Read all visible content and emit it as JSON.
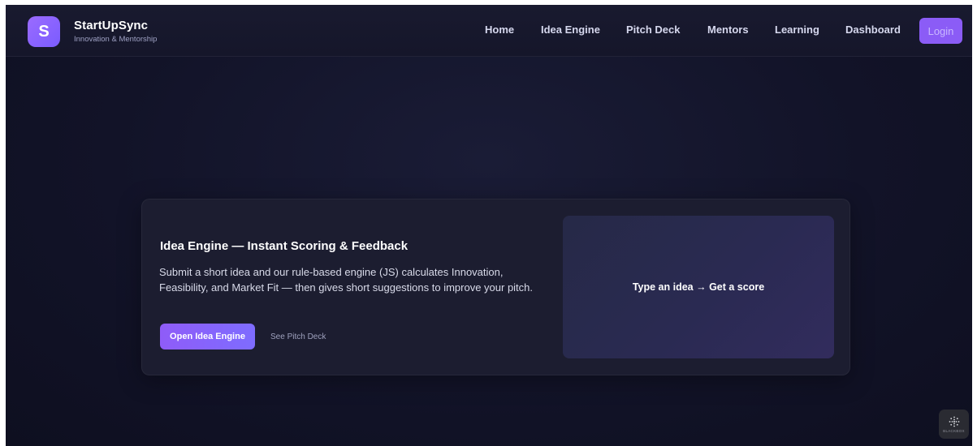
{
  "brand": {
    "initial": "S",
    "name": "StartUpSync",
    "tagline": "Innovation & Mentorship"
  },
  "nav": {
    "links": [
      "Home",
      "Idea Engine",
      "Pitch Deck",
      "Mentors",
      "Learning",
      "Dashboard"
    ],
    "login_label": "Login"
  },
  "hero_card": {
    "title": "Idea Engine — Instant Scoring & Feedback",
    "description": "Submit a short idea and our rule-based engine (JS) calculates Innovation, Feasibility, and Market Fit — then gives short suggestions to improve your pitch.",
    "primary_button": "Open Idea Engine",
    "secondary_button": "See Pitch Deck",
    "preview_text": "Type an idea → Get a score"
  },
  "corner_widget": {
    "icon": "blackbox-logo-icon",
    "label": "BLACKBOX"
  },
  "colors": {
    "accent": "#8b5cf6",
    "background": "#121328",
    "card": "#1c1d30"
  }
}
